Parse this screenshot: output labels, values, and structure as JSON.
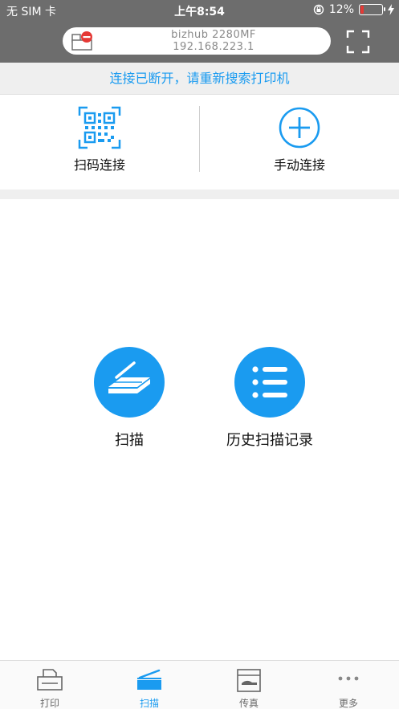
{
  "status_bar": {
    "carrier": "无 SIM 卡",
    "time": "上午8:54",
    "battery": "12%",
    "battery_level": 0.12
  },
  "header": {
    "printer_name": "bizhub 2280MF",
    "printer_ip": "192.168.223.1"
  },
  "banner": {
    "text": "连接已断开，请重新搜索打印机"
  },
  "connect": {
    "qr_label": "扫码连接",
    "manual_label": "手动连接"
  },
  "actions": {
    "scan_label": "扫描",
    "history_label": "历史扫描记录"
  },
  "tabs": [
    {
      "label": "打印",
      "icon": "print-icon",
      "active": false
    },
    {
      "label": "扫描",
      "icon": "scanner-icon",
      "active": true
    },
    {
      "label": "传真",
      "icon": "fax-icon",
      "active": false
    },
    {
      "label": "更多",
      "icon": "more-icon",
      "active": false
    }
  ],
  "colors": {
    "accent": "#1a9bf0",
    "header_bg": "#6d6d6d",
    "disconnect_badge": "#e53935"
  }
}
